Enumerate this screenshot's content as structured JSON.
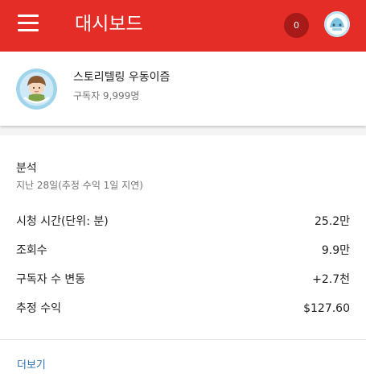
{
  "appbar": {
    "title": "대시보드",
    "notification_count": "0",
    "menu_icon": "hamburger-menu-icon",
    "avatar_icon": "account-avatar-icon",
    "color": "#e52d27"
  },
  "channel": {
    "name": "스토리텔링 우동이즘",
    "subscribers": "구독자 9,999명",
    "avatar_icon": "channel-avatar-icon"
  },
  "analytics": {
    "title": "분석",
    "subtitle": "지난 28일(추정 수익 1일 지연)",
    "metrics": [
      {
        "label": "시청 시간(단위: 분)",
        "value": "25.2만"
      },
      {
        "label": "조회수",
        "value": "9.9만"
      },
      {
        "label": "구독자 수 변동",
        "value": "+2.7천"
      },
      {
        "label": "추정 수익",
        "value": "$127.60"
      }
    ],
    "more_label": "더보기",
    "link_color": "#2a6fb8"
  }
}
